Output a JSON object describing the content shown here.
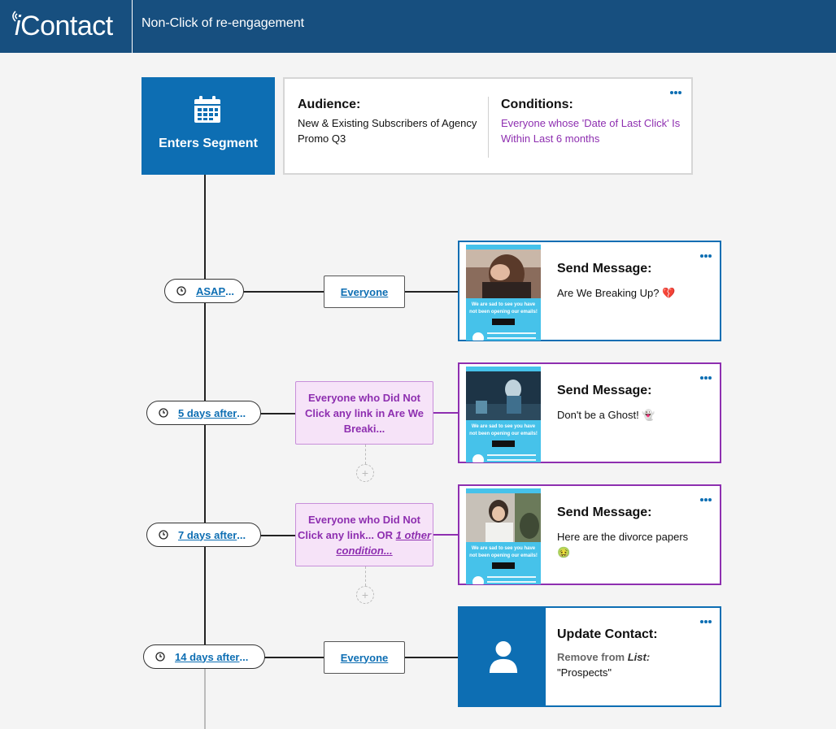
{
  "header": {
    "logo_prefix": "i",
    "logo_rest": "Contact",
    "title": "Non-Click of re-engagement"
  },
  "trigger": {
    "label": "Enters Segment",
    "icon": "calendar-icon",
    "audience_title": "Audience:",
    "audience_text": "New & Existing Subscribers of Agency Promo Q3",
    "conditions_title": "Conditions:",
    "conditions_text": "Everyone whose 'Date of Last Click' Is Within Last 6 months"
  },
  "steps": [
    {
      "timing": "ASAP",
      "filter": "Everyone",
      "action_title": "Send Message:",
      "action_text": "Are We Breaking Up? 💔",
      "thumb_text": "We are sad to see you have not been opening our emails!"
    },
    {
      "timing": "5 days after",
      "filter": "Everyone who Did Not Click any link in Are We Breaki...",
      "action_title": "Send Message:",
      "action_text": "Don't be a Ghost! 👻",
      "thumb_text": "We are sad to see you have not been opening our emails!"
    },
    {
      "timing": "7 days after",
      "filter_prefix": "Everyone who Did Not Click any link... OR ",
      "filter_condition": "1 other condition...",
      "action_title": "Send Message:",
      "action_text": "Here are the divorce papers 🤢",
      "thumb_text": "We are sad to see you have not been opening our emails!"
    },
    {
      "timing": "14 days after",
      "filter": "Everyone",
      "action_title": "Update Contact:",
      "action_label": "Remove from ",
      "action_label_italic": "List:",
      "action_value": "\"Prospects\"",
      "icon": "user-icon"
    }
  ],
  "ellipsis": "...",
  "add_symbol": "+",
  "colors": {
    "header": "#174f7f",
    "brand_blue": "#0d6eb3",
    "condition_purple": "#8e2fb0",
    "filter_bg": "#f6e3f8",
    "thumb_blue": "#46c2ea"
  }
}
